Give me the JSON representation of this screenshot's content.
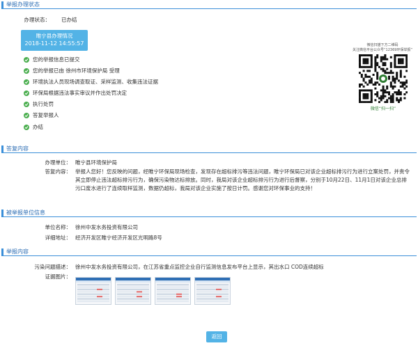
{
  "sections": {
    "status": "举报办理状态",
    "reply": "答复内容",
    "reported_unit": "被举报单位信息",
    "report": "举报内容"
  },
  "status": {
    "label": "办理状态：",
    "value": "已办结",
    "box_title": "睢宁县办理情况",
    "box_time": "2018-11-12 14:55:57",
    "steps": [
      "您的举报信息已提交",
      "您的举报已由 徐州市环境保护局 受理",
      "环境执法人员现场调查取证、采样监测、收集违法证据",
      "环保局根据违法事实审议并作出处罚决定",
      "执行处罚",
      "答复举报人",
      "办结"
    ]
  },
  "qr": {
    "caption_1": "微信扫描下方二维码",
    "caption_2": "关注微信平台公众号“12369环保举报”",
    "footer": "微信“扫一扫”"
  },
  "reply": {
    "unit_label": "办理单位：",
    "unit_value": "睢宁县环境保护局",
    "content_label": "答复内容：",
    "content_value": "举报人您好！您反映的问题，经睢宁环保局现场检查，发现存在超标排污等违法问题，睢宁环保局已对该企业超标排污行为进行立案处罚，并责令其立即停止违法超标排污行为，确保污染物达标排放。同时，我局对该企业超标排污行为进行后督察，分别于10月22日、11月1日对该企业总排污口废水进行了连续取样监测，数据仍超标，我局对该企业实施了按日计罚。感谢您对环保事业的支持！"
  },
  "reported_unit": {
    "name_label": "单位名称：",
    "name_value": "徐州中发水务投资有限公司",
    "address_label": "详细地址：",
    "address_value": "经济开发区睢宁经济开发区光明路8号"
  },
  "report": {
    "problem_label": "污染问题描述：",
    "problem_value": "徐州中发水务投资有限公司，在江苏省重点监控企业自行监测信息发布平台上显示，其出水口 COD连续超标",
    "images_label": "证据图片："
  },
  "back_label": "返回"
}
